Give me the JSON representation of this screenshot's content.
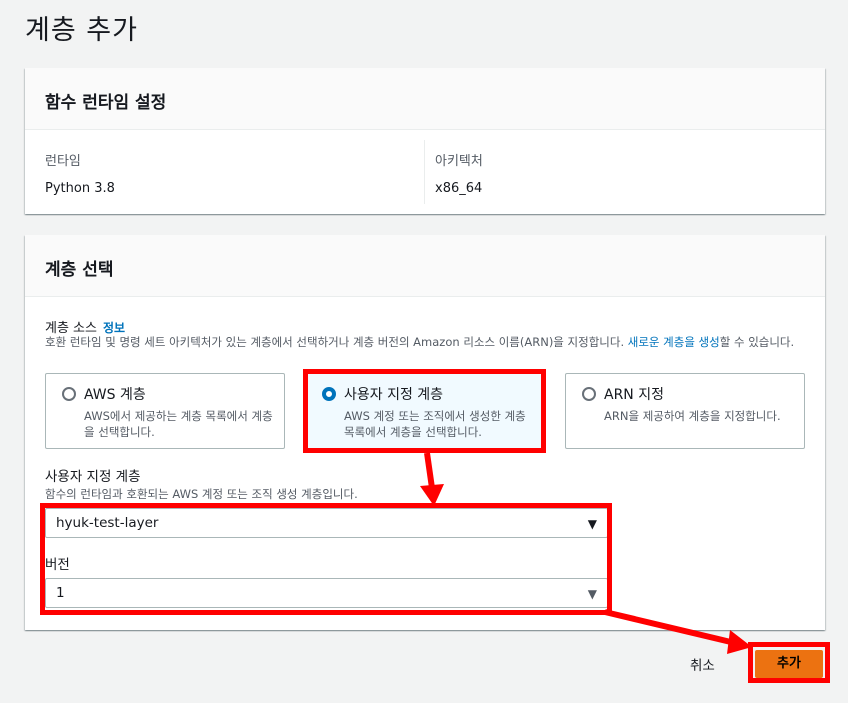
{
  "page": {
    "title": "계층 추가"
  },
  "runtime_panel": {
    "header": "함수 런타임 설정",
    "runtime_label": "런타임",
    "runtime_value": "Python 3.8",
    "arch_label": "아키텍처",
    "arch_value": "x86_64"
  },
  "layer_panel": {
    "header": "계층 선택",
    "source_label": "계층 소스",
    "info_link": "정보",
    "source_desc_part1": "호환 런타임 및 명령 세트 아키텍처가 있는 계층에서 선택하거나 계층 버전의 Amazon 리소스 이름(ARN)을 지정합니다. ",
    "source_desc_link": "새로운 계층을 생성",
    "source_desc_part2": "할 수 있습니다.",
    "options": [
      {
        "title": "AWS 계층",
        "desc": "AWS에서 제공하는 계층 목록에서 계층을 선택합니다.",
        "selected": false
      },
      {
        "title": "사용자 지정 계층",
        "desc": "AWS 계정 또는 조직에서 생성한 계층 목록에서 계층을 선택합니다.",
        "selected": true
      },
      {
        "title": "ARN 지정",
        "desc": "ARN을 제공하여 계층을 지정합니다.",
        "selected": false
      }
    ],
    "custom_label": "사용자 지정 계층",
    "custom_desc": "함수의 런타임과 호환되는 AWS 계정 또는 조직 생성 계층입니다.",
    "layer_select_value": "hyuk-test-layer",
    "version_label": "버전",
    "version_select_value": "1"
  },
  "footer": {
    "cancel_label": "취소",
    "add_label": "추가"
  },
  "colors": {
    "annotation_red": "#ff0000",
    "primary_orange": "#ec7211",
    "accent_blue": "#0073bb"
  },
  "icons": {
    "dropdown": "caret-down-icon",
    "radio": "radio-icon"
  }
}
